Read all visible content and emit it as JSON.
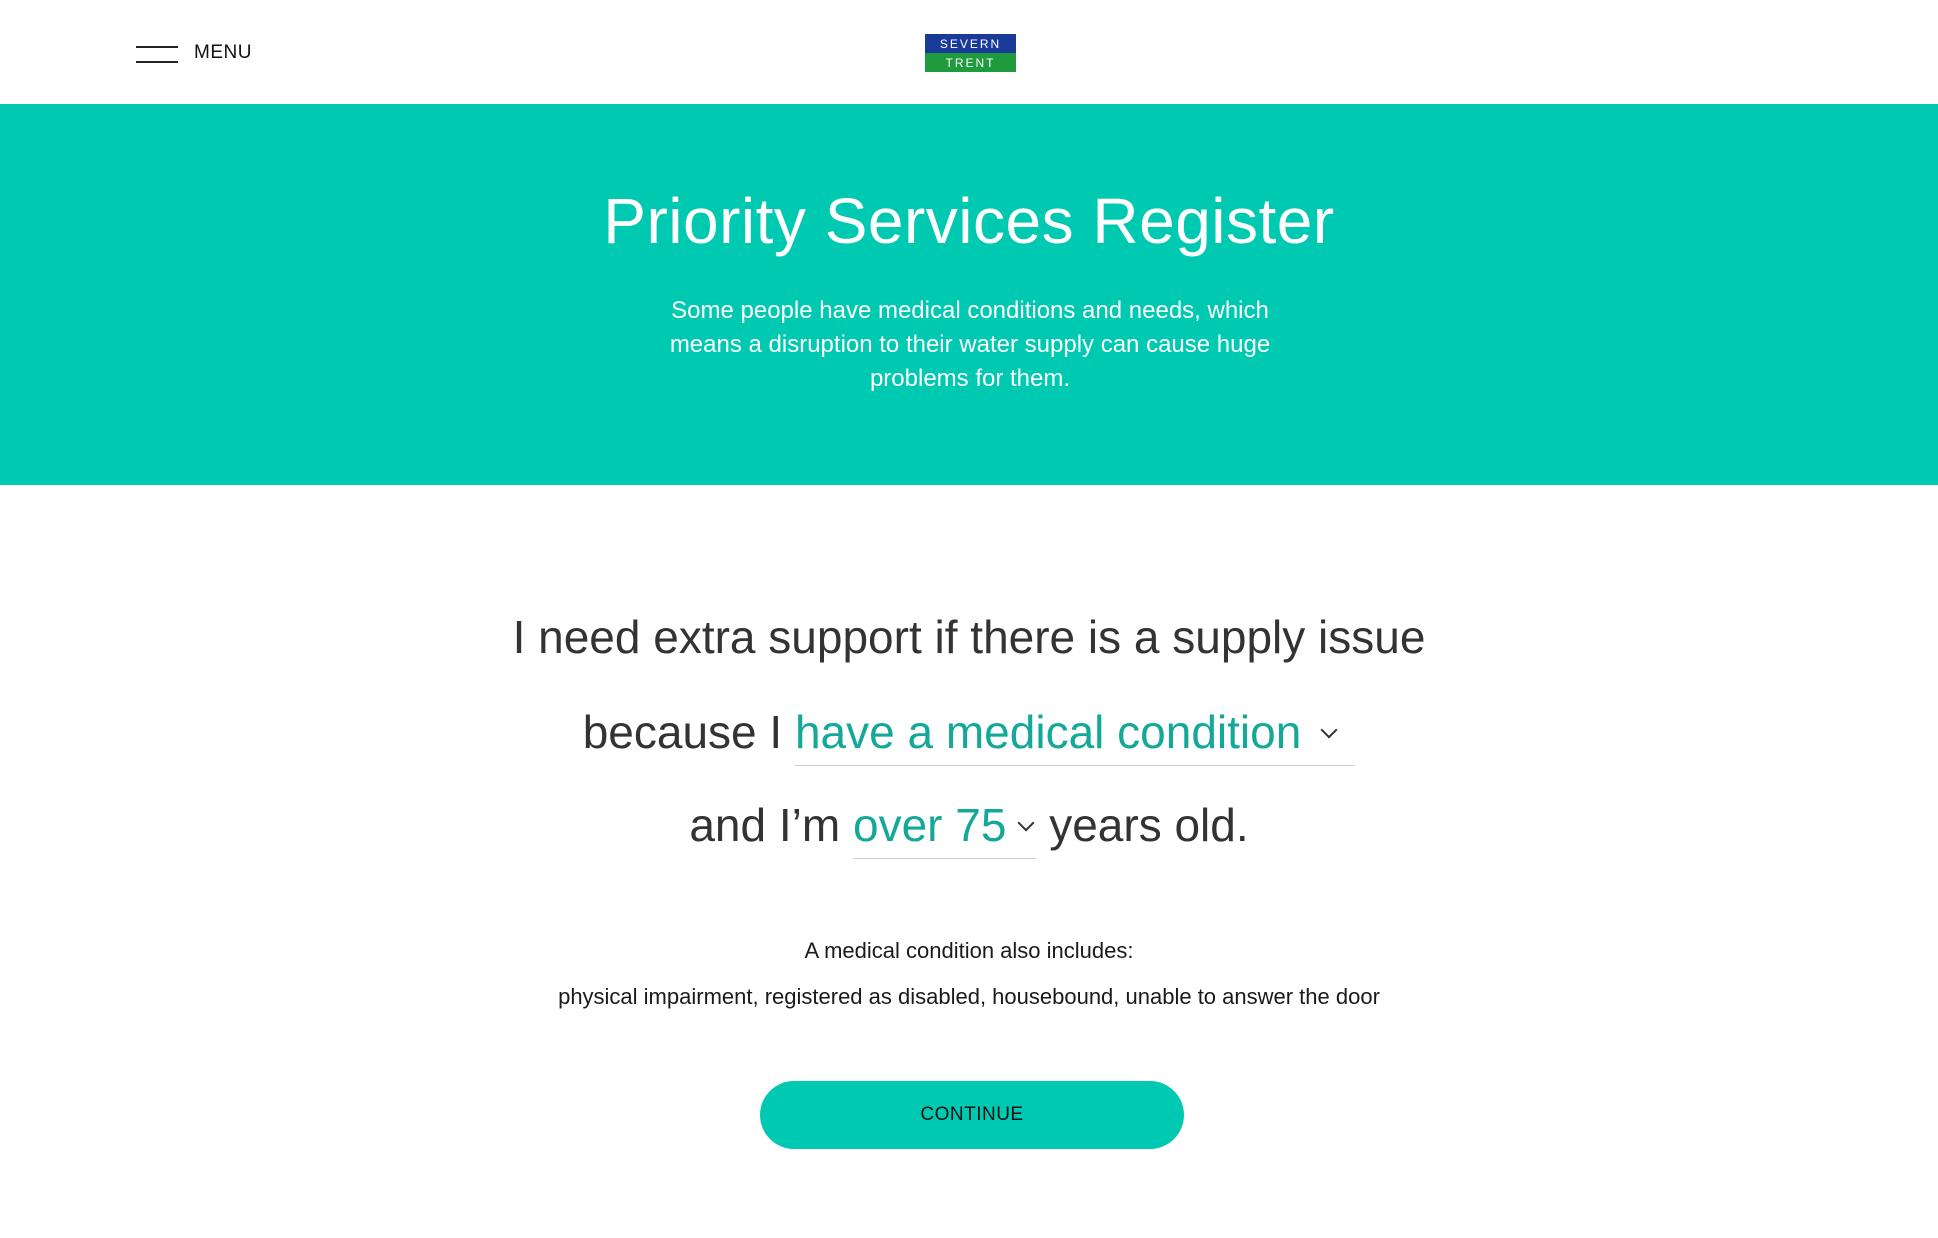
{
  "header": {
    "menu_label": "MENU",
    "logo_top": "SEVERN",
    "logo_bottom": "TRENT"
  },
  "hero": {
    "title": "Priority Services Register",
    "text": "Some people have medical conditions and needs, which means a disruption to their water supply can cause huge problems for them."
  },
  "form": {
    "line1": "I need extra support if there is a supply issue",
    "line2_prefix": "because I",
    "condition_selected": "have a medical condition",
    "line3_prefix": "and I’m",
    "age_selected": "over 75",
    "line3_suffix": "years old."
  },
  "note": {
    "title": "A medical condition also includes:",
    "text": "physical impairment, registered as disabled, housebound, unable to answer the door"
  },
  "actions": {
    "continue_label": "CONTINUE"
  },
  "colors": {
    "accent": "#00c9b1",
    "select_text": "#13a898",
    "logo_blue": "#1a3a9a",
    "logo_green": "#1e9b3d"
  }
}
